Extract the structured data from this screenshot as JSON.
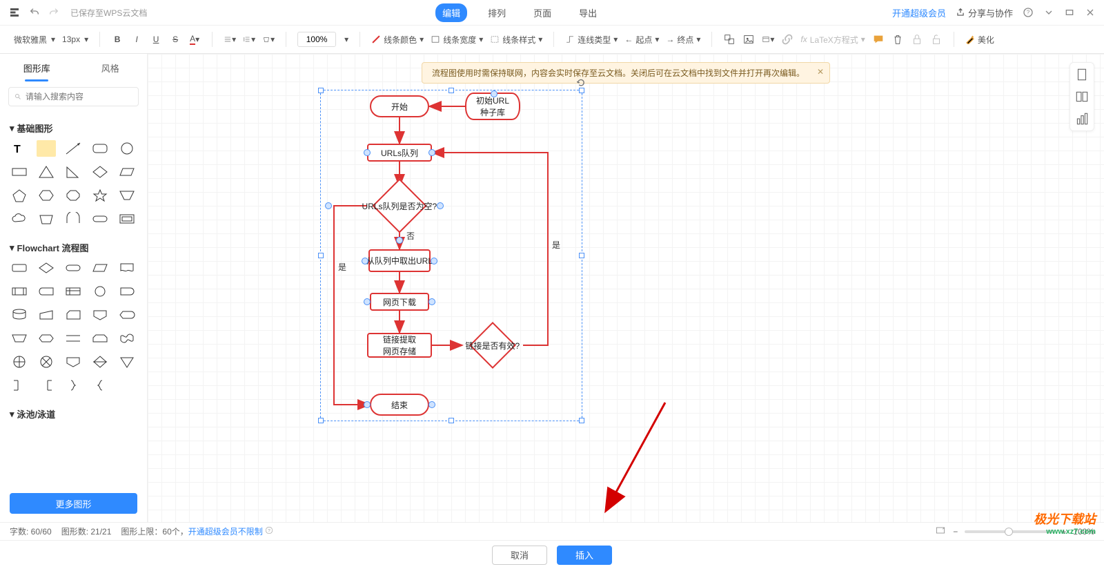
{
  "titlebar": {
    "saved_to": "已保存至WPS云文档",
    "tabs": {
      "edit": "编辑",
      "arrange": "排列",
      "page": "页面",
      "export": "导出"
    },
    "vip": "开通超级会员",
    "share": "分享与协作"
  },
  "toolbar": {
    "font": "微软雅黑",
    "font_size": "13px",
    "zoom": "100%",
    "line_color": "线条颜色",
    "line_width": "线条宽度",
    "line_style": "线条样式",
    "connector": "连线类型",
    "start": "起点",
    "end": "终点",
    "latex": "LaTeX方程式",
    "beautify": "美化"
  },
  "sidebar": {
    "tab_shapes": "图形库",
    "tab_style": "风格",
    "search_placeholder": "请输入搜索内容",
    "section_basic": "基础图形",
    "section_flowchart": "Flowchart 流程图",
    "section_pool": "泳池/泳道",
    "more_shapes": "更多图形"
  },
  "banner": {
    "text": "流程图使用时需保持联网，内容会实时保存至云文档。关闭后可在云文档中找到文件并打开再次编辑。"
  },
  "flow": {
    "start": "开始",
    "seed": "初始URL\n种子库",
    "queue": "URLs队列",
    "empty": "URLs队列是否为空?",
    "pop": "从队列中取出URL",
    "download": "网页下载",
    "extract": "链接提取\n网页存储",
    "valid": "链接是否有效?",
    "end": "结束",
    "yes": "是",
    "no": "否"
  },
  "status": {
    "chars": "字数: 60/60",
    "shapes": "图形数: 21/21",
    "limit_label": "图形上限：",
    "limit_value": "60个，",
    "vip_unlimit": "开通超级会员不限制",
    "zoom": "100%"
  },
  "bottom": {
    "cancel": "取消",
    "insert": "插入"
  },
  "watermark": {
    "brand": "极光下载站",
    "url": "www.xz7.com"
  },
  "right_float": {
    "page": "page",
    "layout": "layout",
    "chart": "chart"
  }
}
